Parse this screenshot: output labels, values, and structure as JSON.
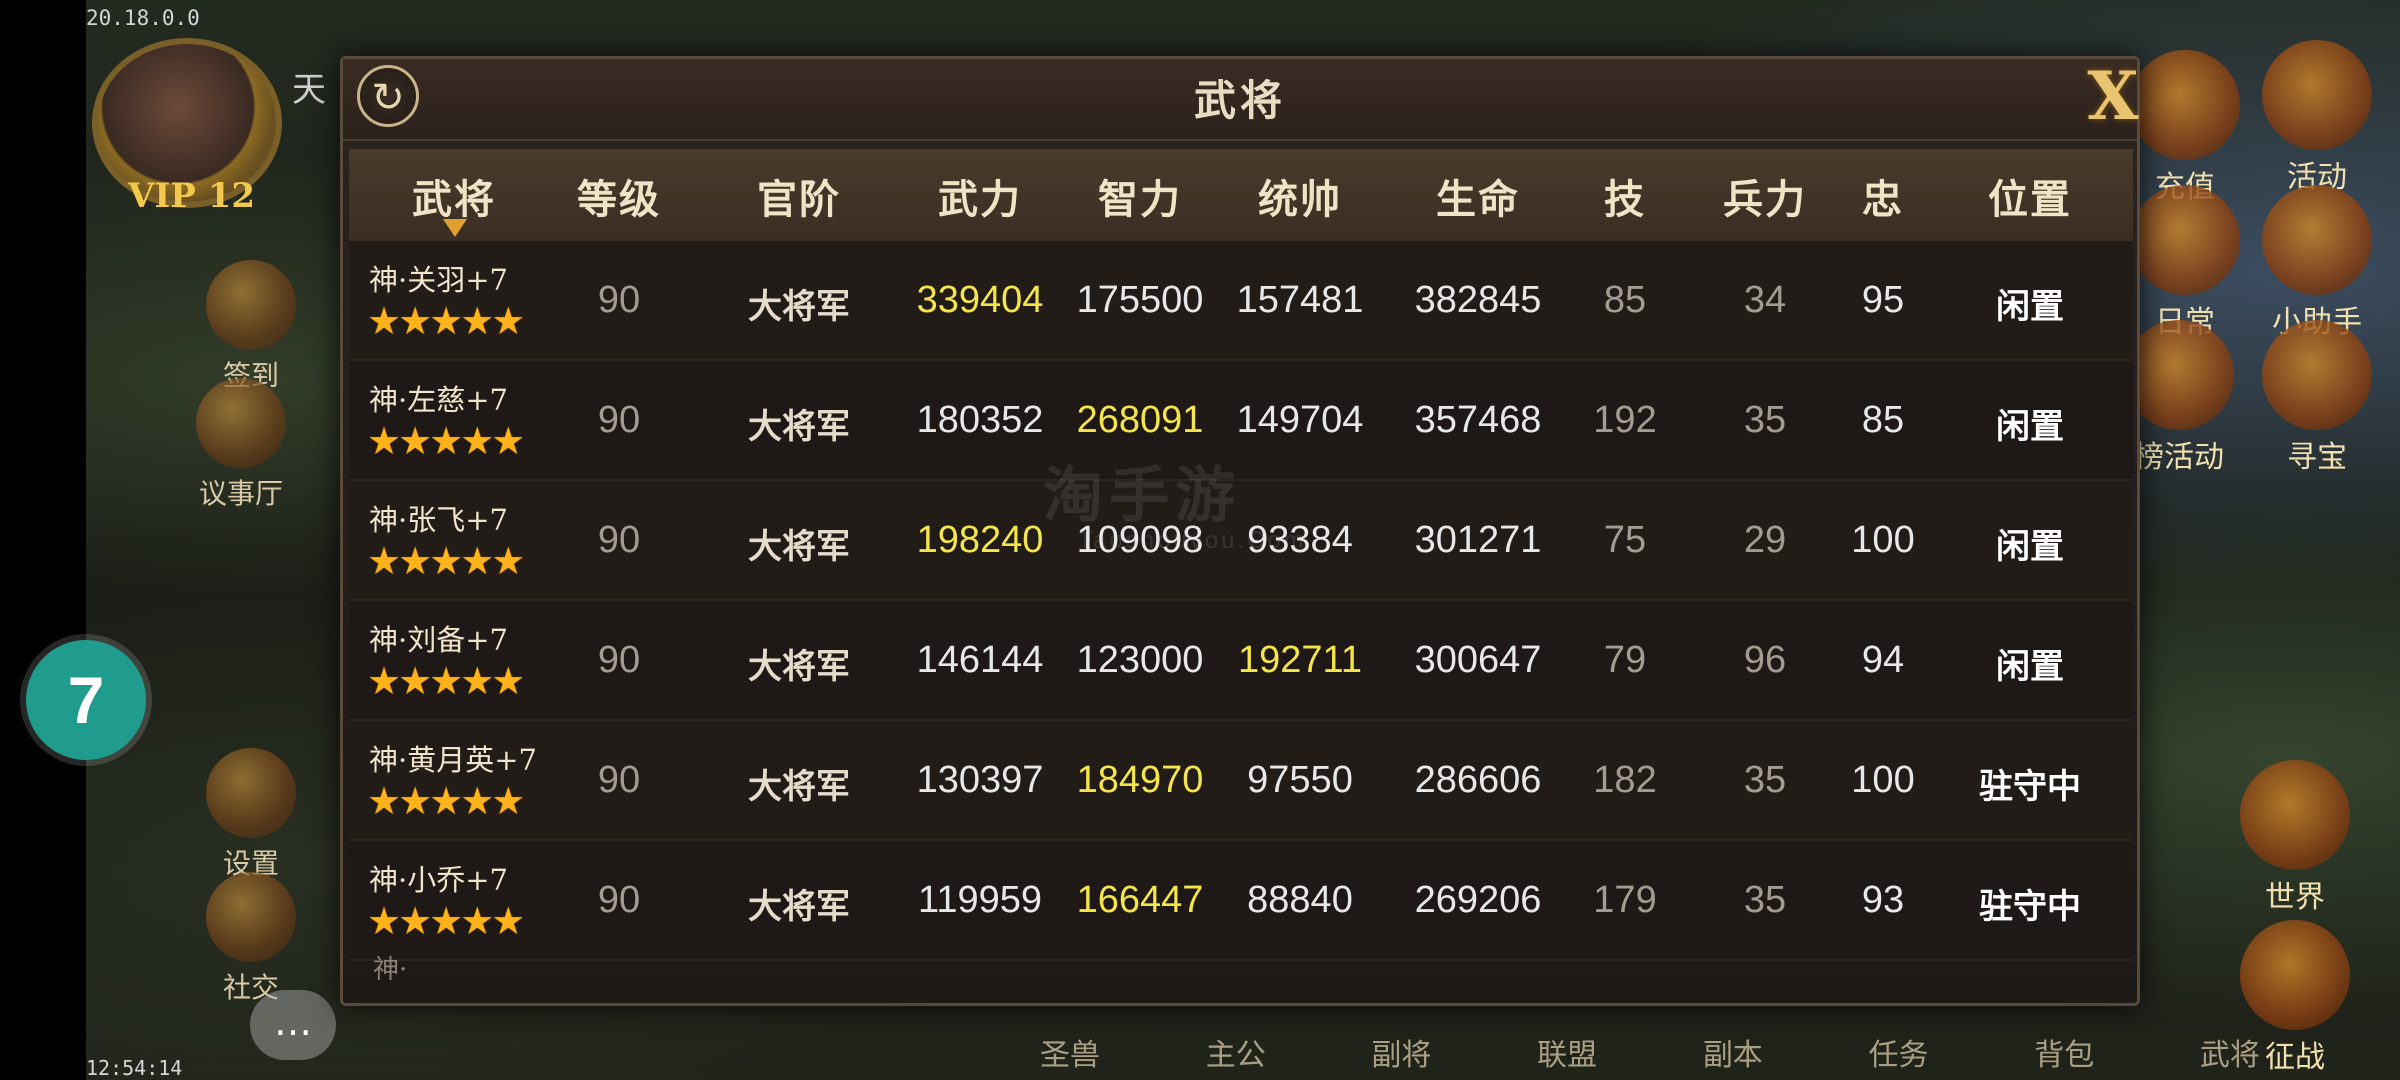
{
  "status": {
    "version": "20.18.0.0",
    "time": "12:54:14"
  },
  "player": {
    "name": "天",
    "vip": "VIP 12"
  },
  "left_menu": [
    {
      "label": "签到",
      "icon": "signin-icon"
    },
    {
      "label": "议事厅",
      "icon": "council-icon"
    },
    {
      "label": "设置",
      "icon": "settings-gear-icon"
    },
    {
      "label": "社交",
      "icon": "social-icon"
    }
  ],
  "right_menu": [
    {
      "label": "充值",
      "icon": "recharge-icon"
    },
    {
      "label": "活动",
      "icon": "gift-icon"
    },
    {
      "label": "日常",
      "icon": "daily-icon"
    },
    {
      "label": "小助手",
      "icon": "scroll-icon"
    },
    {
      "label": "榜活动",
      "icon": "ranking-icon"
    },
    {
      "label": "寻宝",
      "icon": "treasure-icon"
    },
    {
      "label": "世界",
      "icon": "world-dragon-icon"
    },
    {
      "label": "征战",
      "icon": "campaign-dragon-icon"
    }
  ],
  "bottom_nav": [
    "圣兽",
    "主公",
    "副将",
    "联盟",
    "副本",
    "任务",
    "背包",
    "武将"
  ],
  "float_button": "7",
  "modal": {
    "title": "武将",
    "close_label": "X",
    "columns": [
      "武将",
      "等级",
      "官阶",
      "武力",
      "智力",
      "统帅",
      "生命",
      "技",
      "兵力",
      "忠",
      "位置"
    ],
    "rows": [
      {
        "name": "神·关羽+7",
        "stars": "★★★★★",
        "level": "90",
        "rank": "大将军",
        "force": "339404",
        "intel": "175500",
        "command": "157481",
        "life": "382845",
        "skill": "85",
        "troops": "34",
        "loyalty": "95",
        "position": "闲置",
        "highlight": "force"
      },
      {
        "name": "神·左慈+7",
        "stars": "★★★★★",
        "level": "90",
        "rank": "大将军",
        "force": "180352",
        "intel": "268091",
        "command": "149704",
        "life": "357468",
        "skill": "192",
        "troops": "35",
        "loyalty": "85",
        "position": "闲置",
        "highlight": "intel"
      },
      {
        "name": "神·张飞+7",
        "stars": "★★★★★",
        "level": "90",
        "rank": "大将军",
        "force": "198240",
        "intel": "109098",
        "command": "93384",
        "life": "301271",
        "skill": "75",
        "troops": "29",
        "loyalty": "100",
        "position": "闲置",
        "highlight": "force"
      },
      {
        "name": "神·刘备+7",
        "stars": "★★★★★",
        "level": "90",
        "rank": "大将军",
        "force": "146144",
        "intel": "123000",
        "command": "192711",
        "life": "300647",
        "skill": "79",
        "troops": "96",
        "loyalty": "94",
        "position": "闲置",
        "highlight": "command"
      },
      {
        "name": "神·黄月英+7",
        "stars": "★★★★★",
        "level": "90",
        "rank": "大将军",
        "force": "130397",
        "intel": "184970",
        "command": "97550",
        "life": "286606",
        "skill": "182",
        "troops": "35",
        "loyalty": "100",
        "position": "驻守中",
        "highlight": "intel"
      },
      {
        "name": "神·小乔+7",
        "stars": "★★★★★",
        "level": "90",
        "rank": "大将军",
        "force": "119959",
        "intel": "166447",
        "command": "88840",
        "life": "269206",
        "skill": "179",
        "troops": "35",
        "loyalty": "93",
        "position": "驻守中",
        "highlight": "intel"
      }
    ]
  },
  "watermark": {
    "main": "淘手游",
    "sub": "Taoshouyou.Com"
  },
  "colors": {
    "highlight": "#f5e54a",
    "star": "#ffb21a",
    "float_button": "#1f9c8d"
  }
}
